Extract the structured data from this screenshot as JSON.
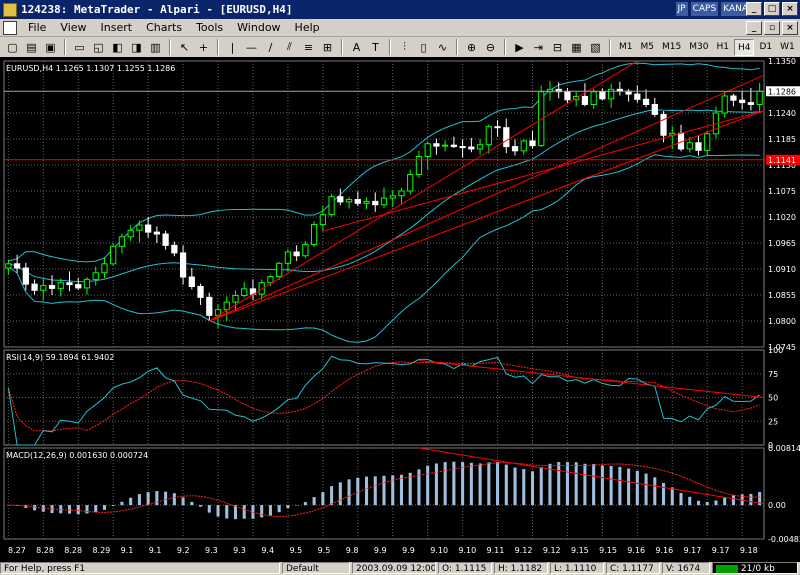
{
  "window": {
    "title": "124238: MetaTrader - Alpari - [EURUSD,H4]",
    "lang": "JP",
    "caps": "CAPS",
    "kana": "KANA"
  },
  "menu": [
    "File",
    "View",
    "Insert",
    "Charts",
    "Tools",
    "Window",
    "Help"
  ],
  "timeframes": [
    "M1",
    "M5",
    "M15",
    "M30",
    "H1",
    "H4",
    "D1",
    "W1"
  ],
  "active_timeframe": "H4",
  "main": {
    "info": "EURUSD,H4  1.1265  1.1307  1.1255  1.1286",
    "ylabels": [
      "1.1350",
      "1.1286",
      "1.1240",
      "1.1185",
      "1.1130",
      "1.1075",
      "1.1020",
      "1.0965",
      "1.0910",
      "1.0855",
      "1.0800",
      "1.0745"
    ],
    "current": "1.1286",
    "hline": "1.1141"
  },
  "rsi": {
    "label": "RSI(14,9)  59.1894  61.9402",
    "ylabels": [
      "100",
      "75",
      "50",
      "25",
      "0"
    ]
  },
  "macd": {
    "label": "MACD(12,26,9)  0.001630  0.000724",
    "ylabels": [
      "0.00814",
      "0.00",
      "-0.00483"
    ]
  },
  "xlabels": [
    "8.27",
    "8.28",
    "8.28",
    "8.29",
    "9.1",
    "9.1",
    "9.2",
    "9.3",
    "9.3",
    "9.4",
    "9.5",
    "9.5",
    "9.8",
    "9.9",
    "9.9",
    "9.10",
    "9.10",
    "9.11",
    "9.12",
    "9.12",
    "9.15",
    "9.15",
    "9.16",
    "9.16",
    "9.17",
    "9.17",
    "9.18"
  ],
  "status": {
    "help": "For Help, press F1",
    "profile": "Default",
    "time": "2003.09.09 12:00",
    "open": "O: 1.1115",
    "high": "H: 1.1182",
    "low": "L: 1.1110",
    "close": "C: 1.1177",
    "volume": "V: 1674",
    "traffic": "21/0 kb"
  },
  "colors": {
    "bull": "#00ff00",
    "bear": "#ffffff",
    "bands": "#20c0d0",
    "trend": "#ff0000",
    "rsi": "#20c0d0",
    "rsi_signal": "#ff2020",
    "macd": "#a0c0e0",
    "macd_signal": "#ff2020",
    "grid": "#606060",
    "axis_text": "#ffffff"
  },
  "icons": [
    "new-chart-icon",
    "open-icon",
    "save-icon",
    "print-icon",
    "print-preview-icon",
    "market-watch-icon",
    "navigator-icon",
    "terminal-icon",
    "crosshair-icon",
    "cursor-icon",
    "vertical-line-icon",
    "horizontal-line-icon",
    "trend-line-icon",
    "channel-icon",
    "fibonacci-icon",
    "text-icon",
    "label-icon",
    "periods-icon",
    "line-chart-icon",
    "candle-icon",
    "bar-chart-icon",
    "zoom-in-icon",
    "zoom-out-icon",
    "autoscroll-icon",
    "chart-shift-icon",
    "grid-icon"
  ],
  "candles": [
    [
      1.0912,
      1.0929,
      1.0898,
      1.0921
    ],
    [
      1.0921,
      1.094,
      1.0902,
      1.0912
    ],
    [
      1.0912,
      1.0923,
      1.0865,
      1.0878
    ],
    [
      1.0878,
      1.0888,
      1.0856,
      1.0865
    ],
    [
      1.0865,
      1.0889,
      1.0843,
      1.0875
    ],
    [
      1.0875,
      1.0897,
      1.0855,
      1.0869
    ],
    [
      1.0869,
      1.089,
      1.0852,
      1.0881
    ],
    [
      1.0881,
      1.0905,
      1.0863,
      1.0877
    ],
    [
      1.0877,
      1.0891,
      1.0866,
      1.087
    ],
    [
      1.087,
      1.0893,
      1.0856,
      1.0888
    ],
    [
      1.0888,
      1.0915,
      1.0875,
      1.0902
    ],
    [
      1.0902,
      1.0935,
      1.0891,
      1.0921
    ],
    [
      1.0921,
      1.0965,
      1.0917,
      1.0958
    ],
    [
      1.0958,
      1.0985,
      1.0943,
      1.0978
    ],
    [
      1.0978,
      1.1003,
      1.0969,
      1.0992
    ],
    [
      1.0992,
      1.1013,
      1.0966,
      1.1003
    ],
    [
      1.1003,
      1.102,
      1.0976,
      1.0988
    ],
    [
      1.0988,
      1.1,
      1.0965,
      1.0984
    ],
    [
      1.0984,
      1.0991,
      1.0951,
      1.096
    ],
    [
      1.096,
      1.0968,
      1.0937,
      1.0944
    ],
    [
      1.0944,
      1.096,
      1.0877,
      1.0893
    ],
    [
      1.0893,
      1.0912,
      1.0867,
      1.0873
    ],
    [
      1.0873,
      1.0879,
      1.0834,
      1.085
    ],
    [
      1.085,
      1.086,
      1.08,
      1.0812
    ],
    [
      1.0812,
      1.0836,
      1.0785,
      1.0824
    ],
    [
      1.0824,
      1.0852,
      1.08,
      1.084
    ],
    [
      1.084,
      1.0865,
      1.0821,
      1.0854
    ],
    [
      1.0854,
      1.0883,
      1.085,
      1.0868
    ],
    [
      1.0868,
      1.0888,
      1.0844,
      1.0857
    ],
    [
      1.0857,
      1.0888,
      1.0845,
      1.0881
    ],
    [
      1.0881,
      1.0898,
      1.0874,
      1.0894
    ],
    [
      1.0894,
      1.0925,
      1.0887,
      1.0922
    ],
    [
      1.0922,
      1.0953,
      1.0905,
      1.0946
    ],
    [
      1.0946,
      1.096,
      1.0927,
      1.0938
    ],
    [
      1.0938,
      1.0969,
      1.0934,
      1.0962
    ],
    [
      1.0962,
      1.1011,
      1.0956,
      1.1004
    ],
    [
      1.1004,
      1.1043,
      1.0989,
      1.1025
    ],
    [
      1.1025,
      1.1069,
      1.102,
      1.1063
    ],
    [
      1.1063,
      1.108,
      1.1045,
      1.1052
    ],
    [
      1.1052,
      1.1063,
      1.1038,
      1.1057
    ],
    [
      1.1057,
      1.1074,
      1.1043,
      1.1049
    ],
    [
      1.1049,
      1.1061,
      1.1037,
      1.1053
    ],
    [
      1.1053,
      1.1072,
      1.1031,
      1.1046
    ],
    [
      1.1046,
      1.1083,
      1.1039,
      1.106
    ],
    [
      1.106,
      1.1077,
      1.1041,
      1.1065
    ],
    [
      1.1065,
      1.1082,
      1.1048,
      1.1075
    ],
    [
      1.1075,
      1.112,
      1.1067,
      1.111
    ],
    [
      1.111,
      1.116,
      1.1103,
      1.1148
    ],
    [
      1.1148,
      1.118,
      1.112,
      1.1175
    ],
    [
      1.1175,
      1.1186,
      1.1152,
      1.117
    ],
    [
      1.117,
      1.1182,
      1.1159,
      1.1172
    ],
    [
      1.1172,
      1.119,
      1.1166,
      1.1169
    ],
    [
      1.1169,
      1.1184,
      1.1146,
      1.1168
    ],
    [
      1.1168,
      1.1187,
      1.1157,
      1.1164
    ],
    [
      1.1164,
      1.1185,
      1.1152,
      1.1173
    ],
    [
      1.1173,
      1.1216,
      1.1154,
      1.1211
    ],
    [
      1.1211,
      1.1225,
      1.119,
      1.1209
    ],
    [
      1.1209,
      1.1228,
      1.1155,
      1.1169
    ],
    [
      1.1169,
      1.1184,
      1.115,
      1.116
    ],
    [
      1.116,
      1.1185,
      1.1152,
      1.1181
    ],
    [
      1.1181,
      1.1202,
      1.1165,
      1.1171
    ],
    [
      1.1171,
      1.1298,
      1.1168,
      1.1285
    ],
    [
      1.1285,
      1.1308,
      1.1266,
      1.129
    ],
    [
      1.129,
      1.1305,
      1.1271,
      1.1285
    ],
    [
      1.1285,
      1.1293,
      1.1261,
      1.1268
    ],
    [
      1.1268,
      1.1286,
      1.1254,
      1.1275
    ],
    [
      1.1275,
      1.1303,
      1.1254,
      1.1258
    ],
    [
      1.1258,
      1.1291,
      1.1249,
      1.1285
    ],
    [
      1.1285,
      1.1292,
      1.1267,
      1.127
    ],
    [
      1.127,
      1.1302,
      1.1251,
      1.129
    ],
    [
      1.129,
      1.1306,
      1.1277,
      1.1286
    ],
    [
      1.1286,
      1.1291,
      1.1264,
      1.128
    ],
    [
      1.128,
      1.1298,
      1.1262,
      1.1269
    ],
    [
      1.1269,
      1.129,
      1.1252,
      1.1258
    ],
    [
      1.1258,
      1.1272,
      1.1232,
      1.1237
    ],
    [
      1.1237,
      1.1244,
      1.1178,
      1.1193
    ],
    [
      1.1193,
      1.1212,
      1.1164,
      1.1197
    ],
    [
      1.1197,
      1.1215,
      1.1159,
      1.1164
    ],
    [
      1.1164,
      1.1189,
      1.1156,
      1.1177
    ],
    [
      1.1177,
      1.1192,
      1.115,
      1.1161
    ],
    [
      1.1161,
      1.1202,
      1.1149,
      1.1196
    ],
    [
      1.1196,
      1.1254,
      1.1186,
      1.124
    ],
    [
      1.124,
      1.1286,
      1.123,
      1.1276
    ],
    [
      1.1276,
      1.1281,
      1.1254,
      1.1267
    ],
    [
      1.1267,
      1.1288,
      1.1247,
      1.1262
    ],
    [
      1.1262,
      1.1293,
      1.1245,
      1.1258
    ],
    [
      1.1258,
      1.1304,
      1.124,
      1.1286
    ]
  ]
}
